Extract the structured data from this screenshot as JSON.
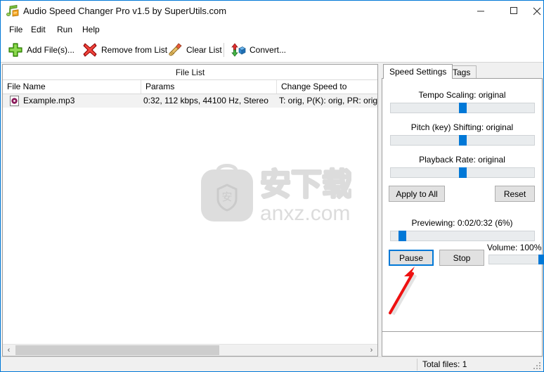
{
  "window": {
    "title": "Audio Speed Changer Pro v1.5 by SuperUtils.com",
    "icon": "music-note-icon",
    "accent_color": "#0078d7",
    "minimize_label": "–",
    "maximize_label": "□",
    "close_label": "✕"
  },
  "menu": {
    "items": [
      {
        "label": "File"
      },
      {
        "label": "Edit"
      },
      {
        "label": "Run"
      },
      {
        "label": "Help"
      }
    ]
  },
  "toolbar": {
    "buttons": [
      {
        "label": "Add File(s)...",
        "icon": "green-plus-icon"
      },
      {
        "label": "Remove from List",
        "icon": "red-x-icon"
      },
      {
        "label": "Clear List",
        "icon": "broom-icon"
      },
      {
        "label": "Convert...",
        "icon": "convert-cube-icon"
      }
    ]
  },
  "file_list": {
    "caption": "File List",
    "columns": [
      {
        "label": "File Name"
      },
      {
        "label": "Params"
      },
      {
        "label": "Change Speed to"
      }
    ],
    "rows": [
      {
        "icon": "mp3-file-icon",
        "file_name": "Example.mp3",
        "params": "0:32, 112 kbps, 44100 Hz, Stereo",
        "change_speed_to": "T: orig, P(K): orig, PR: orig"
      }
    ],
    "scroll_left_label": "‹",
    "scroll_right_label": "›"
  },
  "settings": {
    "tabs": [
      {
        "label": "Speed Settings",
        "active": true
      },
      {
        "label": "Tags",
        "active": false
      }
    ],
    "sliders": [
      {
        "label": "Tempo Scaling: original",
        "value_pct": 50
      },
      {
        "label": "Pitch (key) Shifting: original",
        "value_pct": 50
      },
      {
        "label": "Playback Rate: original",
        "value_pct": 50
      }
    ],
    "apply_to_all_label": "Apply to All",
    "reset_label": "Reset",
    "preview": {
      "status": "Previewing: 0:02/0:32 (6%)",
      "progress_pct": 6,
      "pause_label": "Pause",
      "stop_label": "Stop"
    },
    "volume": {
      "label": "Volume: 100%",
      "value_pct": 100
    }
  },
  "status_bar": {
    "total_files": "Total files: 1"
  },
  "watermark": {
    "text_cn": "安下载",
    "text_en": "anxz.com",
    "badge_char": "安"
  },
  "annotation": {
    "arrow": "red-arrow-pointing-to-pause",
    "color": "#ee1111"
  }
}
